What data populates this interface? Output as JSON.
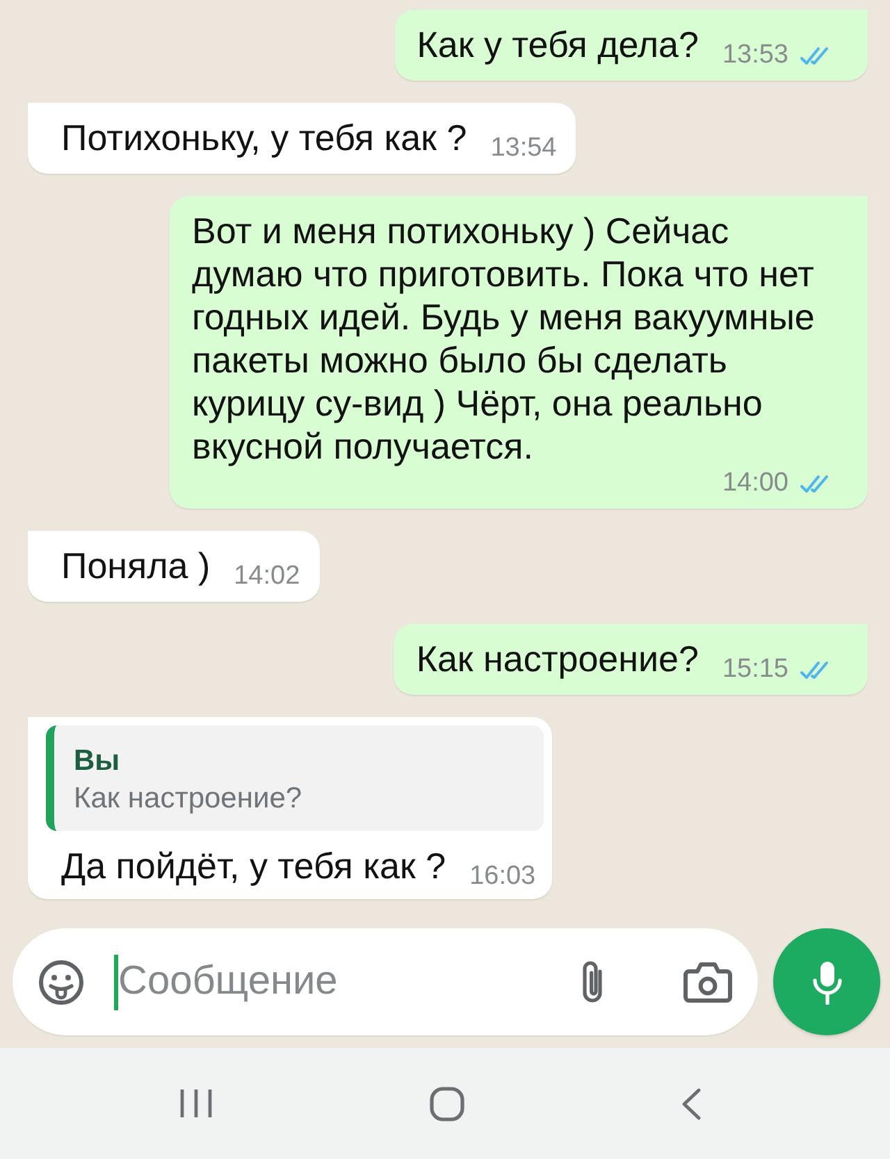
{
  "messages": [
    {
      "kind": "outgoing",
      "text": "Как у тебя дела?",
      "time": "13:53",
      "read": true
    },
    {
      "kind": "incoming",
      "text": "Потихоньку, у тебя как ?",
      "time": "13:54"
    },
    {
      "kind": "outgoing",
      "text": "Вот и меня потихоньку ) Сейчас думаю что приготовить. Пока что нет годных идей. Будь у меня вакуумные пакеты можно было бы сделать курицу су-вид ) Чёрт, она реально вкусной получается.",
      "time": "14:00",
      "read": true
    },
    {
      "kind": "incoming",
      "text": "Поняла )",
      "time": "14:02"
    },
    {
      "kind": "outgoing",
      "text": "Как настроение?",
      "time": "15:15",
      "read": true
    },
    {
      "kind": "incoming",
      "quote": {
        "author": "Вы",
        "text": "Как настроение?"
      },
      "text": "Да пойдёт, у тебя как ?",
      "time": "16:03"
    }
  ],
  "composer": {
    "placeholder": "Сообщение",
    "focused": true
  }
}
